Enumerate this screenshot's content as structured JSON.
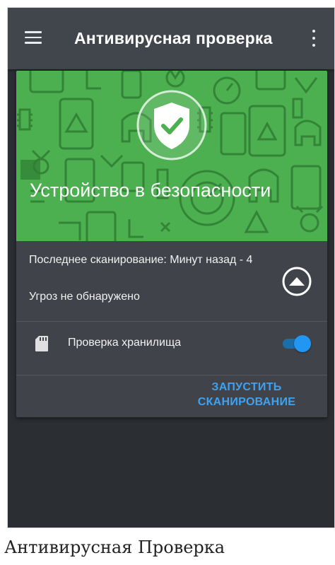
{
  "app_bar": {
    "title": "Антивирусная проверка",
    "menu_icon": "hamburger-menu-icon",
    "more_icon": "more-vert-icon"
  },
  "status_card": {
    "hero_color": "#4caf50",
    "shield_icon": "shield-check-icon",
    "status_title": "Устройство в безопасности",
    "last_scan": "Последнее сканирование: Минут назад - 4",
    "threats": "Угроз не обнаружено",
    "collapse_icon": "chevron-up-circle-icon",
    "storage_icon": "sd-card-icon",
    "storage_label": "Проверка хранилища",
    "storage_toggle_on": true,
    "scan_button": "ЗАПУСТИТЬ СКАНИРОВАНИЕ",
    "accent_color": "#2196f3"
  },
  "caption": "Антивирусная Проверка"
}
